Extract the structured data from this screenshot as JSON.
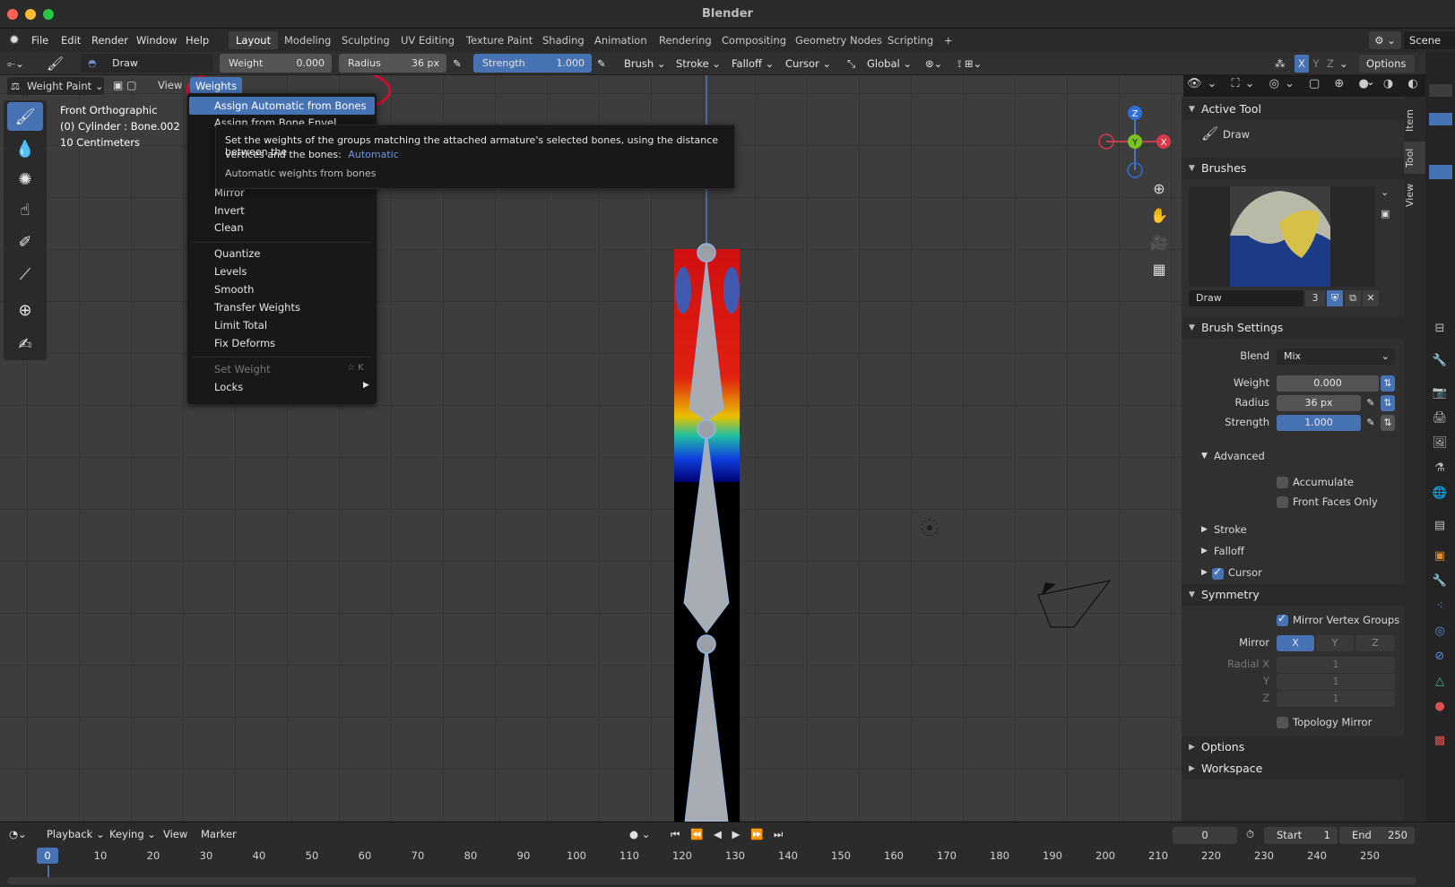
{
  "window": {
    "title": "Blender"
  },
  "menubar": {
    "items": [
      "File",
      "Edit",
      "Render",
      "Window",
      "Help"
    ]
  },
  "workspaces": {
    "tabs": [
      "Layout",
      "Modeling",
      "Sculpting",
      "UV Editing",
      "Texture Paint",
      "Shading",
      "Animation",
      "Rendering",
      "Compositing",
      "Geometry Nodes",
      "Scripting"
    ],
    "add": "+",
    "scene": "Scene"
  },
  "toolheader": {
    "brush_name": "Draw",
    "weight_label": "Weight",
    "weight_value": "0.000",
    "radius_label": "Radius",
    "radius_value": "36 px",
    "strength_label": "Strength",
    "strength_value": "1.000",
    "brush_menu": "Brush",
    "stroke_menu": "Stroke",
    "falloff_menu": "Falloff",
    "cursor_menu": "Cursor",
    "orientation": "Global",
    "axes": [
      "X",
      "Y",
      "Z"
    ],
    "options": "Options"
  },
  "viewport_header": {
    "mode": "Weight Paint",
    "view": "View",
    "weights": "Weights"
  },
  "viewport_info": {
    "line1": "Front Orthographic",
    "line2": "(0) Cylinder : Bone.002",
    "line3": "10 Centimeters"
  },
  "gizmo": {
    "z": "Z",
    "y": "Y",
    "x": "X"
  },
  "weights_menu": {
    "highlighted": "Assign Automatic from Bones",
    "partial": "Assign from Bone Envel...",
    "items_a": [
      "Mirror",
      "Invert",
      "Clean"
    ],
    "items_b": [
      "Quantize",
      "Levels",
      "Smooth",
      "Transfer Weights",
      "Limit Total",
      "Fix Deforms"
    ],
    "set_weight": "Set Weight",
    "set_weight_shortcut": "☆ K",
    "locks": "Locks"
  },
  "tooltip": {
    "line1": "Set the weights of the groups matching the attached armature's selected bones, using the distance between the",
    "line2": "vertices and the bones:",
    "highlight": "Automatic",
    "line3": "Automatic weights from bones"
  },
  "npanel": {
    "active_tool": {
      "header": "Active Tool",
      "tool": "Draw"
    },
    "brushes": {
      "header": "Brushes",
      "name": "Draw",
      "users": "3"
    },
    "brush_settings": {
      "header": "Brush Settings",
      "blend_label": "Blend",
      "blend_value": "Mix",
      "weight_label": "Weight",
      "weight_value": "0.000",
      "radius_label": "Radius",
      "radius_value": "36 px",
      "strength_label": "Strength",
      "strength_value": "1.000",
      "advanced": "Advanced",
      "accumulate": "Accumulate",
      "front_faces": "Front Faces Only",
      "stroke": "Stroke",
      "falloff": "Falloff",
      "cursor": "Cursor"
    },
    "symmetry": {
      "header": "Symmetry",
      "mirror_vertex_groups": "Mirror Vertex Groups",
      "mirror_label": "Mirror",
      "axes": [
        "X",
        "Y",
        "Z"
      ],
      "radial_x_label": "Radial X",
      "radial_y_label": "Y",
      "radial_z_label": "Z",
      "radial_values": [
        "1",
        "1",
        "1"
      ],
      "topology_mirror": "Topology Mirror"
    },
    "options": "Options",
    "workspace": "Workspace"
  },
  "sidetabs": [
    "Item",
    "Tool",
    "View"
  ],
  "timeline": {
    "menus": [
      "Playback",
      "Keying",
      "View",
      "Marker"
    ],
    "current_frame": "0",
    "start_label": "Start",
    "start_value": "1",
    "end_label": "End",
    "end_value": "250",
    "ticks": [
      "0",
      "10",
      "20",
      "30",
      "40",
      "50",
      "60",
      "70",
      "80",
      "90",
      "100",
      "110",
      "120",
      "130",
      "140",
      "150",
      "160",
      "170",
      "180",
      "190",
      "200",
      "210",
      "220",
      "230",
      "240",
      "250"
    ]
  },
  "colors": {
    "accent": "#4772b3",
    "highlight_ring": "#c8102e",
    "bg_viewport": "#3d3d3d",
    "panel": "#303030"
  }
}
